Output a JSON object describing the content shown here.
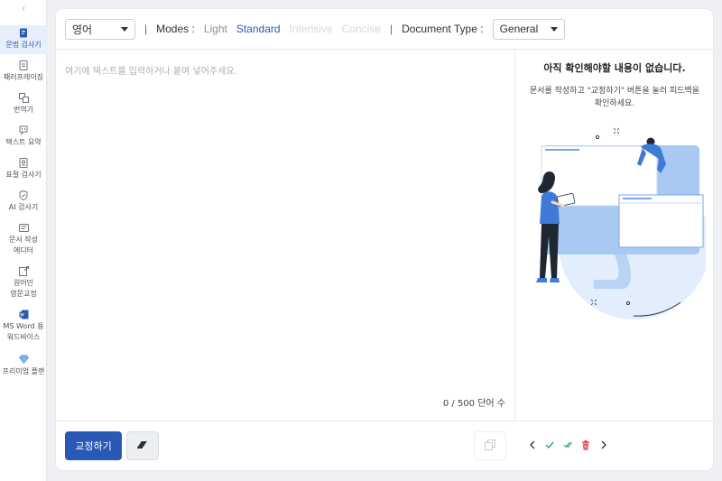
{
  "sidebar": {
    "collapse_glyph": "‹",
    "items": [
      {
        "label": "문법 검사기",
        "icon": "grammar-check-icon"
      },
      {
        "label": "패러프레이징",
        "icon": "paraphrase-icon"
      },
      {
        "label": "번역기",
        "icon": "translate-icon"
      },
      {
        "label": "텍스트 요약",
        "icon": "summary-icon"
      },
      {
        "label": "표절 검사기",
        "icon": "plagiarism-icon"
      },
      {
        "label": "AI 검사기",
        "icon": "ai-check-icon"
      },
      {
        "label": "문서 작성\n에디터",
        "icon": "document-editor-icon"
      },
      {
        "label": "원어민\n영문교정",
        "icon": "native-proofreading-icon"
      },
      {
        "label": "MS Word 용\n워드바이스",
        "icon": "ms-word-icon"
      },
      {
        "label": "프리미엄 플랜",
        "icon": "diamond-icon"
      }
    ]
  },
  "toolbar": {
    "language": "영어",
    "separator": "|",
    "modes_label": "Modes :",
    "modes": [
      {
        "label": "Light",
        "state": "enabled"
      },
      {
        "label": "Standard",
        "state": "selected"
      },
      {
        "label": "Intensive",
        "state": "disabled"
      },
      {
        "label": "Concise",
        "state": "disabled"
      }
    ],
    "doc_type_label": "Document Type :",
    "doc_type": "General"
  },
  "editor": {
    "placeholder": "여기에 텍스트를 입력하거나 붙여 넣어주세요.",
    "counter": "0 / 500 단어 수"
  },
  "feedback": {
    "title": "아직 확인해야할 내용이 없습니다.",
    "description": "문서를 작성하고 \"교정하기\" 버튼을 눌러 피드백을 확인하세요."
  },
  "bottom": {
    "proofread_label": "교정하기"
  },
  "colors": {
    "accent": "#2a58b5",
    "mode_selected": "#2a58b5",
    "mode_enabled": "#8a9099",
    "mode_disabled": "#d5d8dd",
    "accept": "#2fa86a",
    "delete": "#e0454a"
  }
}
